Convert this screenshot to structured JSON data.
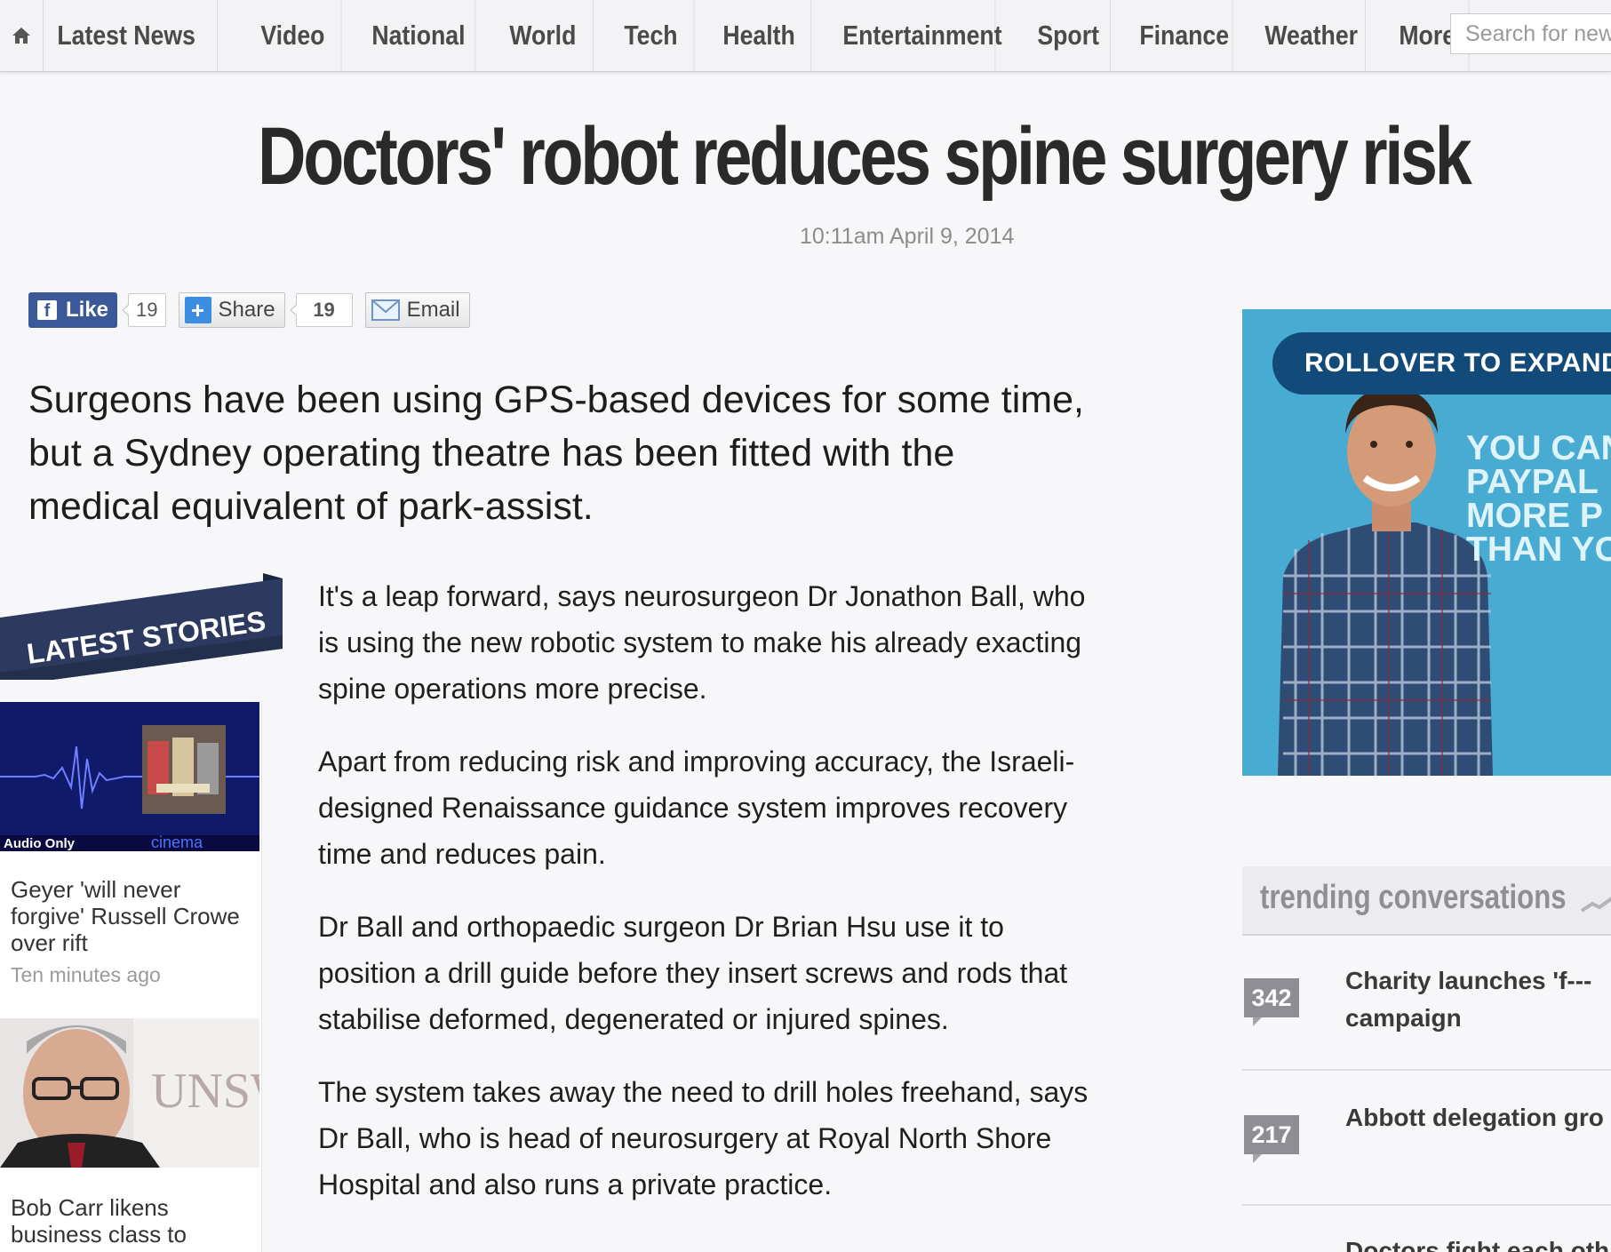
{
  "nav": {
    "items": [
      {
        "label": "Latest News"
      },
      {
        "label": "Video"
      },
      {
        "label": "National"
      },
      {
        "label": "World"
      },
      {
        "label": "Tech"
      },
      {
        "label": "Health"
      },
      {
        "label": "Entertainment"
      },
      {
        "label": "Sport"
      },
      {
        "label": "Finance"
      },
      {
        "label": "Weather"
      },
      {
        "label": "More"
      }
    ],
    "search_placeholder": "Search for new"
  },
  "article": {
    "headline": "Doctors' robot reduces spine surgery risk",
    "timestamp": "10:11am April 9, 2014",
    "lead": "Surgeons have been using GPS-based devices for some time, but a Sydney operating theatre has been fitted with the medical equivalent of park-assist.",
    "paragraphs": [
      "It's a leap forward, says neurosurgeon Dr Jonathon Ball, who is using the new robotic system to make his already exacting spine operations more precise.",
      "Apart from reducing risk and improving accuracy, the Israeli-designed Renaissance guidance system improves recovery time and reduces pain.",
      "Dr Ball and orthopaedic surgeon Dr Brian Hsu use it to position a drill guide before they insert screws and rods that stabilise deformed, degenerated or injured spines.",
      "The system takes away the need to drill holes freehand, says Dr Ball, who is head of neurosurgery at Royal North Shore Hospital and also runs a private practice."
    ]
  },
  "social": {
    "like_label": "Like",
    "like_count": "19",
    "share_label": "Share",
    "share_count": "19",
    "email_label": "Email"
  },
  "latest_stories": {
    "title": "LATEST STORIES",
    "stories": [
      {
        "title": "Geyer 'will never forgive' Russell Crowe over rift",
        "time": "Ten minutes ago",
        "image_caption": "Audio Only",
        "image_brand": "cinema"
      },
      {
        "title": "Bob Carr likens business class to",
        "image_brand": "UNSW"
      }
    ]
  },
  "ad": {
    "button": "ROLLOVER TO EXPAND",
    "text_lines": [
      "YOU CAN",
      "PAYPAL",
      "MORE P",
      "THAN YO"
    ]
  },
  "trending": {
    "title": "trending conversations",
    "items": [
      {
        "count": "342",
        "title_line1": "Charity launches 'f---",
        "title_line2": "campaign"
      },
      {
        "count": "217",
        "title_line1": "Abbott delegation gro",
        "title_line2": ""
      },
      {
        "title_line1": "Doctors fight each oth"
      }
    ]
  }
}
